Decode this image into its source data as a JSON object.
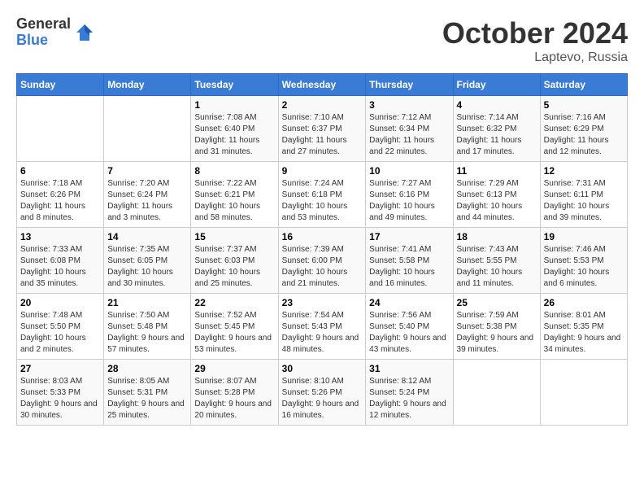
{
  "header": {
    "logo_general": "General",
    "logo_blue": "Blue",
    "month": "October 2024",
    "location": "Laptevo, Russia"
  },
  "days_of_week": [
    "Sunday",
    "Monday",
    "Tuesday",
    "Wednesday",
    "Thursday",
    "Friday",
    "Saturday"
  ],
  "weeks": [
    [
      {
        "day": "",
        "info": ""
      },
      {
        "day": "",
        "info": ""
      },
      {
        "day": "1",
        "sunrise": "7:08 AM",
        "sunset": "6:40 PM",
        "daylight": "11 hours and 31 minutes."
      },
      {
        "day": "2",
        "sunrise": "7:10 AM",
        "sunset": "6:37 PM",
        "daylight": "11 hours and 27 minutes."
      },
      {
        "day": "3",
        "sunrise": "7:12 AM",
        "sunset": "6:34 PM",
        "daylight": "11 hours and 22 minutes."
      },
      {
        "day": "4",
        "sunrise": "7:14 AM",
        "sunset": "6:32 PM",
        "daylight": "11 hours and 17 minutes."
      },
      {
        "day": "5",
        "sunrise": "7:16 AM",
        "sunset": "6:29 PM",
        "daylight": "11 hours and 12 minutes."
      }
    ],
    [
      {
        "day": "6",
        "sunrise": "7:18 AM",
        "sunset": "6:26 PM",
        "daylight": "11 hours and 8 minutes."
      },
      {
        "day": "7",
        "sunrise": "7:20 AM",
        "sunset": "6:24 PM",
        "daylight": "11 hours and 3 minutes."
      },
      {
        "day": "8",
        "sunrise": "7:22 AM",
        "sunset": "6:21 PM",
        "daylight": "10 hours and 58 minutes."
      },
      {
        "day": "9",
        "sunrise": "7:24 AM",
        "sunset": "6:18 PM",
        "daylight": "10 hours and 53 minutes."
      },
      {
        "day": "10",
        "sunrise": "7:27 AM",
        "sunset": "6:16 PM",
        "daylight": "10 hours and 49 minutes."
      },
      {
        "day": "11",
        "sunrise": "7:29 AM",
        "sunset": "6:13 PM",
        "daylight": "10 hours and 44 minutes."
      },
      {
        "day": "12",
        "sunrise": "7:31 AM",
        "sunset": "6:11 PM",
        "daylight": "10 hours and 39 minutes."
      }
    ],
    [
      {
        "day": "13",
        "sunrise": "7:33 AM",
        "sunset": "6:08 PM",
        "daylight": "10 hours and 35 minutes."
      },
      {
        "day": "14",
        "sunrise": "7:35 AM",
        "sunset": "6:05 PM",
        "daylight": "10 hours and 30 minutes."
      },
      {
        "day": "15",
        "sunrise": "7:37 AM",
        "sunset": "6:03 PM",
        "daylight": "10 hours and 25 minutes."
      },
      {
        "day": "16",
        "sunrise": "7:39 AM",
        "sunset": "6:00 PM",
        "daylight": "10 hours and 21 minutes."
      },
      {
        "day": "17",
        "sunrise": "7:41 AM",
        "sunset": "5:58 PM",
        "daylight": "10 hours and 16 minutes."
      },
      {
        "day": "18",
        "sunrise": "7:43 AM",
        "sunset": "5:55 PM",
        "daylight": "10 hours and 11 minutes."
      },
      {
        "day": "19",
        "sunrise": "7:46 AM",
        "sunset": "5:53 PM",
        "daylight": "10 hours and 6 minutes."
      }
    ],
    [
      {
        "day": "20",
        "sunrise": "7:48 AM",
        "sunset": "5:50 PM",
        "daylight": "10 hours and 2 minutes."
      },
      {
        "day": "21",
        "sunrise": "7:50 AM",
        "sunset": "5:48 PM",
        "daylight": "9 hours and 57 minutes."
      },
      {
        "day": "22",
        "sunrise": "7:52 AM",
        "sunset": "5:45 PM",
        "daylight": "9 hours and 53 minutes."
      },
      {
        "day": "23",
        "sunrise": "7:54 AM",
        "sunset": "5:43 PM",
        "daylight": "9 hours and 48 minutes."
      },
      {
        "day": "24",
        "sunrise": "7:56 AM",
        "sunset": "5:40 PM",
        "daylight": "9 hours and 43 minutes."
      },
      {
        "day": "25",
        "sunrise": "7:59 AM",
        "sunset": "5:38 PM",
        "daylight": "9 hours and 39 minutes."
      },
      {
        "day": "26",
        "sunrise": "8:01 AM",
        "sunset": "5:35 PM",
        "daylight": "9 hours and 34 minutes."
      }
    ],
    [
      {
        "day": "27",
        "sunrise": "8:03 AM",
        "sunset": "5:33 PM",
        "daylight": "9 hours and 30 minutes."
      },
      {
        "day": "28",
        "sunrise": "8:05 AM",
        "sunset": "5:31 PM",
        "daylight": "9 hours and 25 minutes."
      },
      {
        "day": "29",
        "sunrise": "8:07 AM",
        "sunset": "5:28 PM",
        "daylight": "9 hours and 20 minutes."
      },
      {
        "day": "30",
        "sunrise": "8:10 AM",
        "sunset": "5:26 PM",
        "daylight": "9 hours and 16 minutes."
      },
      {
        "day": "31",
        "sunrise": "8:12 AM",
        "sunset": "5:24 PM",
        "daylight": "9 hours and 12 minutes."
      },
      {
        "day": "",
        "info": ""
      },
      {
        "day": "",
        "info": ""
      }
    ]
  ],
  "labels": {
    "sunrise": "Sunrise:",
    "sunset": "Sunset:",
    "daylight": "Daylight:"
  }
}
